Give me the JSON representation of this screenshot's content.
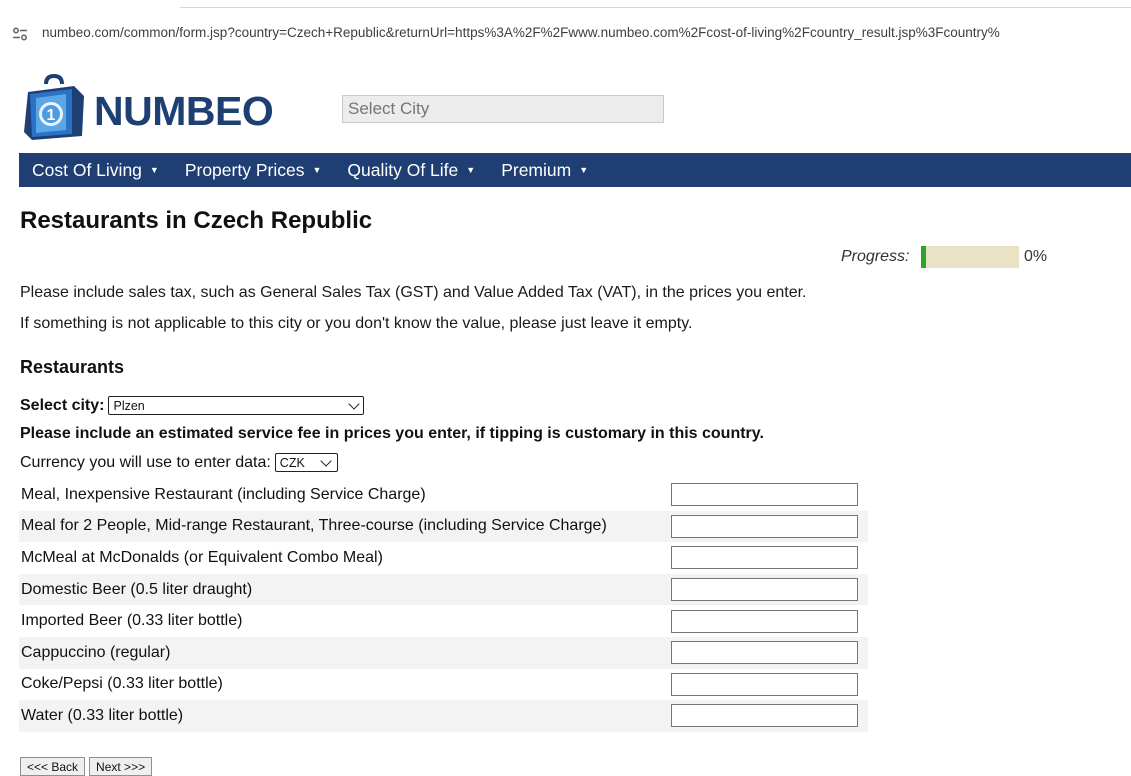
{
  "browser": {
    "url": "numbeo.com/common/form.jsp?country=Czech+Republic&returnUrl=https%3A%2F%2Fwww.numbeo.com%2Fcost-of-living%2Fcountry_result.jsp%3Fcountry%"
  },
  "header": {
    "logo_text": "NUMBEO",
    "search_placeholder": "Select City"
  },
  "nav": {
    "items": [
      {
        "label": "Cost Of Living"
      },
      {
        "label": "Property Prices"
      },
      {
        "label": "Quality Of Life"
      },
      {
        "label": "Premium"
      }
    ]
  },
  "page": {
    "title": "Restaurants in Czech Republic",
    "progress_label": "Progress:",
    "progress_value": "0%",
    "progress_fraction": 0.0,
    "note_tax": "Please include sales tax, such as General Sales Tax (GST) and Value Added Tax (VAT), in the prices you enter.",
    "note_empty": "If something is not applicable to this city or you don't know the value, please just leave it empty.",
    "section_title": "Restaurants",
    "select_city_label": "Select city:",
    "selected_city": "Plzen",
    "tip_note": "Please include an estimated service fee in prices you enter, if tipping is customary in this country.",
    "currency_label": "Currency you will use to enter data:",
    "selected_currency": "CZK",
    "items": [
      {
        "label": "Meal, Inexpensive Restaurant (including Service Charge)",
        "value": ""
      },
      {
        "label": "Meal for 2 People, Mid-range Restaurant, Three-course (including Service Charge)",
        "value": ""
      },
      {
        "label": "McMeal at McDonalds (or Equivalent Combo Meal)",
        "value": ""
      },
      {
        "label": "Domestic Beer (0.5 liter draught)",
        "value": ""
      },
      {
        "label": "Imported Beer (0.33 liter bottle)",
        "value": ""
      },
      {
        "label": "Cappuccino (regular)",
        "value": ""
      },
      {
        "label": "Coke/Pepsi (0.33 liter bottle)",
        "value": ""
      },
      {
        "label": "Water (0.33 liter bottle)",
        "value": ""
      }
    ],
    "back_button": "<<< Back",
    "next_button": "Next >>>"
  },
  "colors": {
    "brand_navy": "#1f3f74",
    "progress_fill": "#2ea32e",
    "progress_track": "#e9e2c5"
  }
}
